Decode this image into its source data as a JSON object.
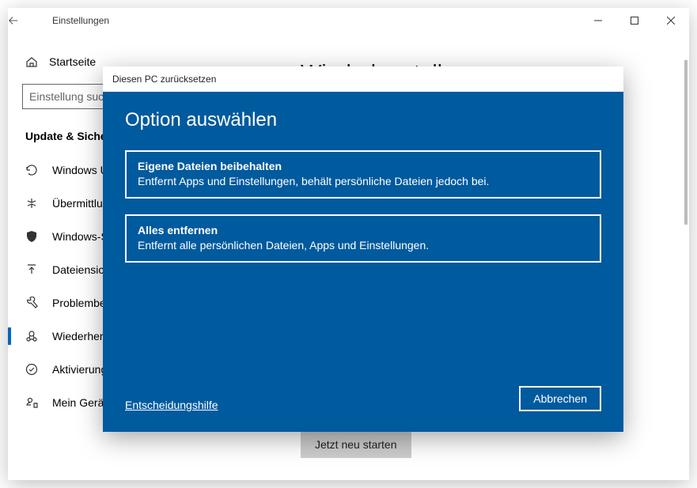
{
  "titlebar": {
    "title": "Einstellungen"
  },
  "sidebar": {
    "home": "Startseite",
    "search_placeholder": "Einstellung suchen",
    "section": "Update & Sicherheit",
    "items": [
      {
        "label": "Windows Update"
      },
      {
        "label": "Übermittlungsoptimierung"
      },
      {
        "label": "Windows-Sicherheit"
      },
      {
        "label": "Dateiensicherung"
      },
      {
        "label": "Problembehandlung"
      },
      {
        "label": "Wiederherstellung"
      },
      {
        "label": "Aktivierung"
      },
      {
        "label": "Mein Gerät suchen"
      }
    ]
  },
  "main": {
    "heading": "Wiederherstellung",
    "restart_button": "Jetzt neu starten"
  },
  "modal": {
    "window_title": "Diesen PC zurücksetzen",
    "heading": "Option auswählen",
    "options": [
      {
        "title": "Eigene Dateien beibehalten",
        "description": "Entfernt Apps und Einstellungen, behält persönliche Dateien jedoch bei."
      },
      {
        "title": "Alles entfernen",
        "description": "Entfernt alle persönlichen Dateien, Apps und Einstellungen."
      }
    ],
    "help_link": "Entscheidungshilfe",
    "cancel": "Abbrechen"
  }
}
